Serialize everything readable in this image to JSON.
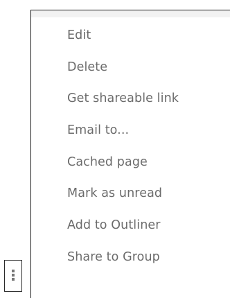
{
  "menu": {
    "items": [
      {
        "label": "Edit"
      },
      {
        "label": "Delete"
      },
      {
        "label": "Get shareable link"
      },
      {
        "label": "Email to..."
      },
      {
        "label": "Cached page"
      },
      {
        "label": "Mark as unread"
      },
      {
        "label": "Add to Outliner"
      },
      {
        "label": "Share to Group"
      }
    ]
  },
  "more_button": {
    "icon": "more-vertical-icon"
  },
  "colors": {
    "menu_text": "#6b6b6b",
    "menu_border": "#1a1a1a",
    "menu_topbar": "#f2f2f2",
    "icon": "#777777"
  }
}
